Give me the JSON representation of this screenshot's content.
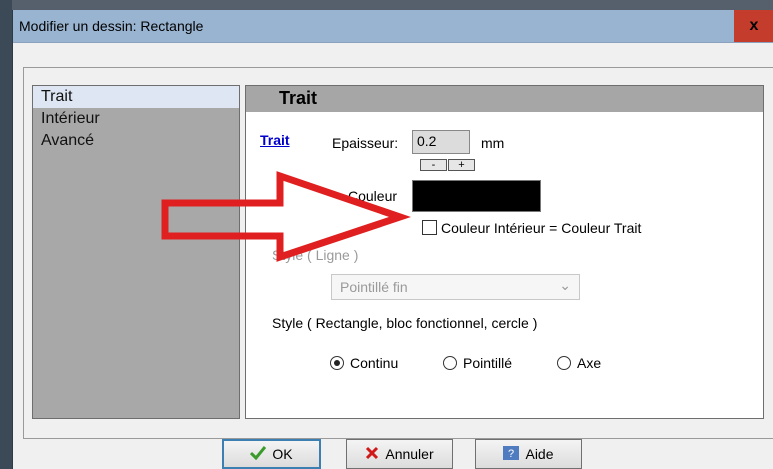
{
  "window": {
    "title": "Modifier un dessin: Rectangle",
    "close_label": "x"
  },
  "nav": {
    "items": [
      {
        "label": "Trait",
        "selected": true
      },
      {
        "label": "Intérieur",
        "selected": false
      },
      {
        "label": "Avancé",
        "selected": false
      }
    ]
  },
  "panel": {
    "header": "Trait",
    "section_link": "Trait",
    "thickness_label": "Epaisseur:",
    "thickness_value": "0.2",
    "thickness_unit": "mm",
    "decrement_label": "-",
    "increment_label": "+",
    "color_label": "Couleur",
    "color_value": "#000000",
    "checkbox_label": "Couleur Intérieur = Couleur Trait",
    "checkbox_checked": false,
    "line_style_label": "Style ( Ligne )",
    "line_style_value": "Pointillé fin",
    "rect_style_label": "Style ( Rectangle, bloc fonctionnel, cercle )",
    "rect_style_options": [
      {
        "label": "Continu",
        "selected": true
      },
      {
        "label": "Pointillé",
        "selected": false
      },
      {
        "label": "Axe",
        "selected": false
      }
    ]
  },
  "buttons": {
    "ok": "OK",
    "cancel": "Annuler",
    "help": "Aide"
  },
  "colors": {
    "annotation_arrow": "#e02020",
    "titlebar": "#99b4d1"
  }
}
